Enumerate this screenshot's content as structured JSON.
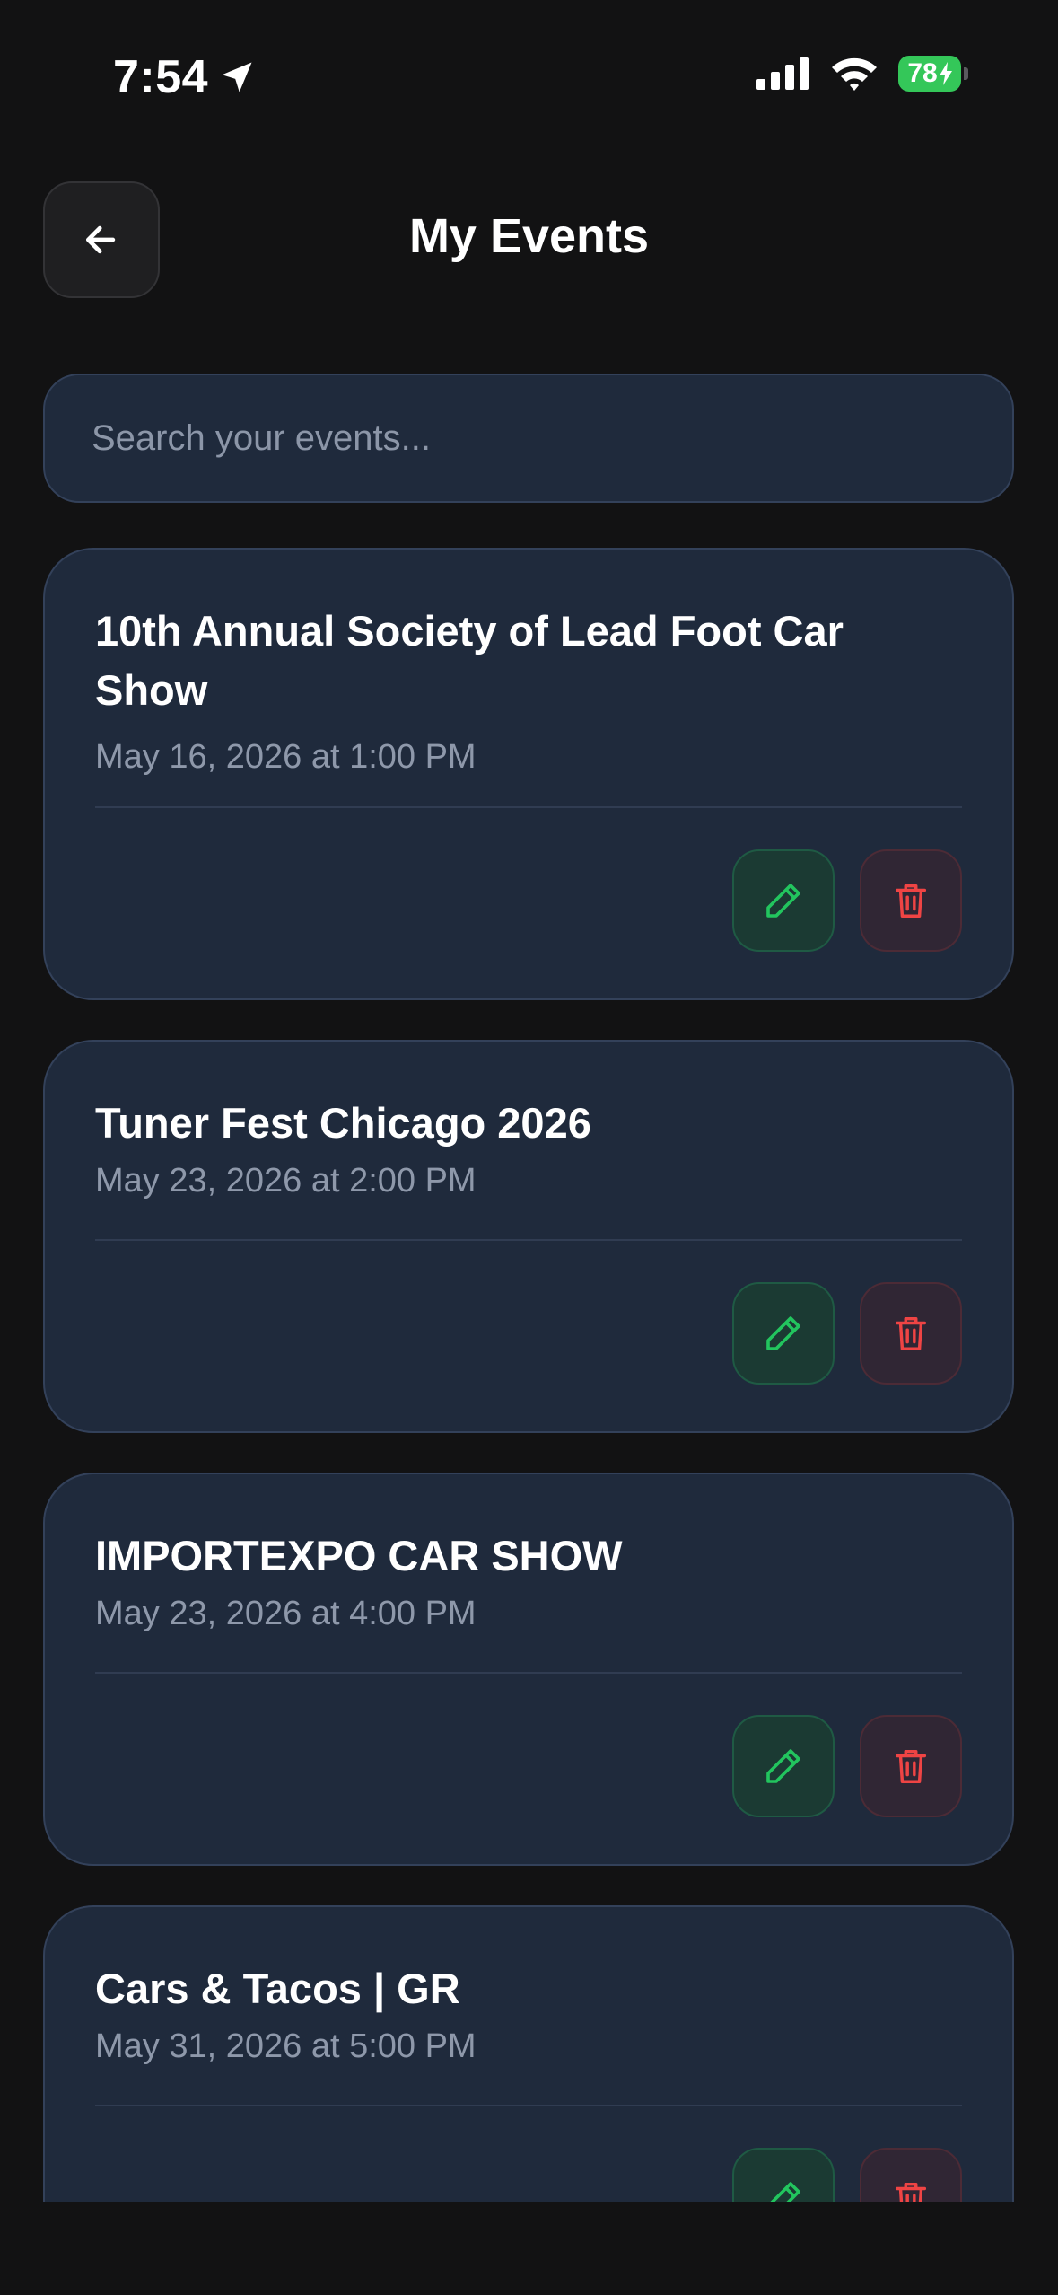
{
  "status_bar": {
    "time": "7:54",
    "battery_level": "78"
  },
  "header": {
    "title": "My Events"
  },
  "search": {
    "placeholder": "Search your events..."
  },
  "colors": {
    "background": "#121213",
    "card": "#1f2a3c",
    "edit_accent": "#22c55e",
    "delete_accent": "#ef4444",
    "battery": "#34c759"
  },
  "events": [
    {
      "title": "10th Annual Society of Lead Foot Car Show",
      "date": "May 16, 2026 at 1:00 PM"
    },
    {
      "title": "Tuner Fest Chicago 2026",
      "date": "May 23, 2026 at 2:00 PM"
    },
    {
      "title": "IMPORTEXPO CAR SHOW",
      "date": "May 23, 2026 at 4:00 PM"
    },
    {
      "title": "Cars & Tacos | GR",
      "date": "May 31, 2026 at 5:00 PM"
    }
  ]
}
